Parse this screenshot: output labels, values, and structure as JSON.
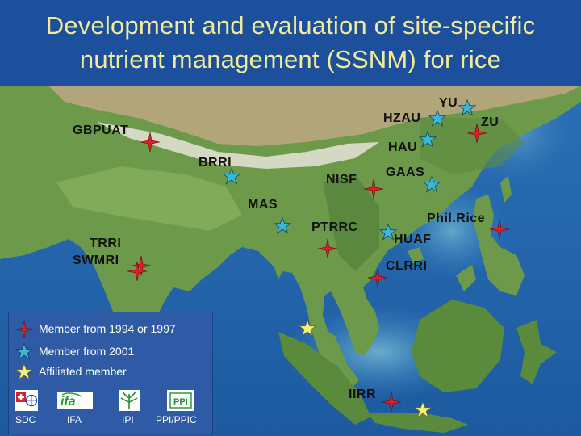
{
  "title": {
    "line1": "Development and evaluation of site-specific",
    "line2": "nutrient management (SSNM) for rice"
  },
  "sites": [
    {
      "name": "GBPUAT",
      "type": "member-1994-1997"
    },
    {
      "name": "BRRI",
      "type": "member-2001"
    },
    {
      "name": "HZAU",
      "type": "member-2001"
    },
    {
      "name": "YU",
      "type": "member-2001"
    },
    {
      "name": "ZU",
      "type": "member-1994-1997"
    },
    {
      "name": "HAU",
      "type": "member-2001"
    },
    {
      "name": "GAAS",
      "type": "member-2001"
    },
    {
      "name": "NISF",
      "type": "member-1994-1997"
    },
    {
      "name": "MAS",
      "type": "member-2001"
    },
    {
      "name": "PTRRC",
      "type": "member-1994-1997"
    },
    {
      "name": "Phil.Rice",
      "type": "member-1994-1997"
    },
    {
      "name": "HUAF",
      "type": "member-2001"
    },
    {
      "name": "TRRI",
      "type": "member-1994-1997"
    },
    {
      "name": "SWMRI",
      "type": "member-1994-1997"
    },
    {
      "name": "CLRRI",
      "type": "member-1994-1997"
    },
    {
      "name": "IIRR",
      "type": "member-1994-1997"
    }
  ],
  "legend": {
    "items": [
      {
        "label": "Member from 1994 or 1997",
        "icon": "red-star-icon"
      },
      {
        "label": "Member from 2001",
        "icon": "cyan-star-icon"
      },
      {
        "label": "Affiliated member",
        "icon": "yellow-star-icon"
      }
    ],
    "logos": [
      {
        "label": "SDC",
        "icon": "sdc-logo"
      },
      {
        "label": "IFA",
        "icon": "ifa-logo"
      },
      {
        "label": "IPI",
        "icon": "ipi-logo"
      },
      {
        "label": "PPI/PPIC",
        "icon": "ppi-logo"
      }
    ]
  },
  "colors": {
    "title_bg": "#1c4f9c",
    "title_text": "#f2ec9a",
    "member_1994_1997": "#d8202a",
    "member_2001": "#3ab6d8",
    "affiliated": "#f5f07a"
  }
}
